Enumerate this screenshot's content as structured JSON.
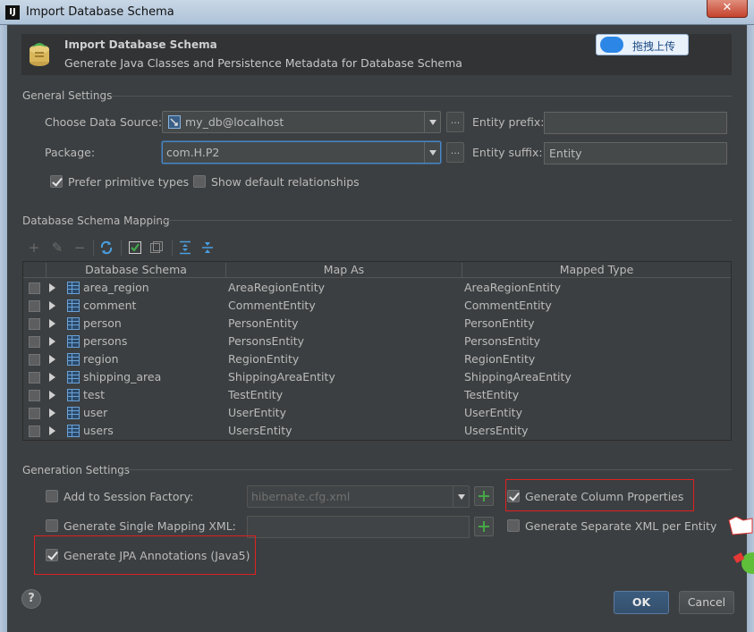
{
  "window": {
    "title": "Import Database Schema",
    "close_glyph": "✕",
    "app_icon": "IJ"
  },
  "header": {
    "title": "Import Database Schema",
    "subtitle": "Generate Java Classes and Persistence Metadata for Database Schema",
    "upload_label": "拖拽上传"
  },
  "general": {
    "section": "General Settings",
    "data_source_label": "Choose Data Source:",
    "data_source_value": "my_db@localhost",
    "package_label": "Package:",
    "package_value": "com.H.P2",
    "entity_prefix_label": "Entity prefix:",
    "entity_prefix_value": "",
    "entity_suffix_label": "Entity suffix:",
    "entity_suffix_value": "Entity",
    "dots": "...",
    "prefer_primitive_label": "Prefer primitive types",
    "prefer_primitive_checked": true,
    "show_default_rel_label": "Show default relationships",
    "show_default_rel_checked": false
  },
  "mapping": {
    "section": "Database Schema Mapping",
    "columns": [
      "Database Schema",
      "Map As",
      "Mapped Type"
    ],
    "rows": [
      {
        "schema": "area_region",
        "map_as": "AreaRegionEntity",
        "type": "AreaRegionEntity"
      },
      {
        "schema": "comment",
        "map_as": "CommentEntity",
        "type": "CommentEntity"
      },
      {
        "schema": "person",
        "map_as": "PersonEntity",
        "type": "PersonEntity"
      },
      {
        "schema": "persons",
        "map_as": "PersonsEntity",
        "type": "PersonsEntity"
      },
      {
        "schema": "region",
        "map_as": "RegionEntity",
        "type": "RegionEntity"
      },
      {
        "schema": "shipping_area",
        "map_as": "ShippingAreaEntity",
        "type": "ShippingAreaEntity"
      },
      {
        "schema": "test",
        "map_as": "TestEntity",
        "type": "TestEntity"
      },
      {
        "schema": "user",
        "map_as": "UserEntity",
        "type": "UserEntity"
      },
      {
        "schema": "users",
        "map_as": "UsersEntity",
        "type": "UsersEntity"
      }
    ]
  },
  "generation": {
    "section": "Generation Settings",
    "add_session_factory_label": "Add to Session Factory:",
    "add_session_factory_checked": false,
    "session_factory_value": "hibernate.cfg.xml",
    "single_mapping_label": "Generate Single Mapping XML:",
    "single_mapping_checked": false,
    "single_mapping_value": "",
    "jpa_label": "Generate JPA Annotations (Java5)",
    "jpa_checked": true,
    "column_props_label": "Generate Column Properties",
    "column_props_checked": true,
    "separate_xml_label": "Generate Separate XML per Entity",
    "separate_xml_checked": false
  },
  "footer": {
    "help": "?",
    "ok": "OK",
    "cancel": "Cancel"
  },
  "colors": {
    "background": "#3c3f41",
    "highlight_box": "#e02020",
    "ok_button": "#3b5c7f",
    "focus": "#4a88c7"
  }
}
